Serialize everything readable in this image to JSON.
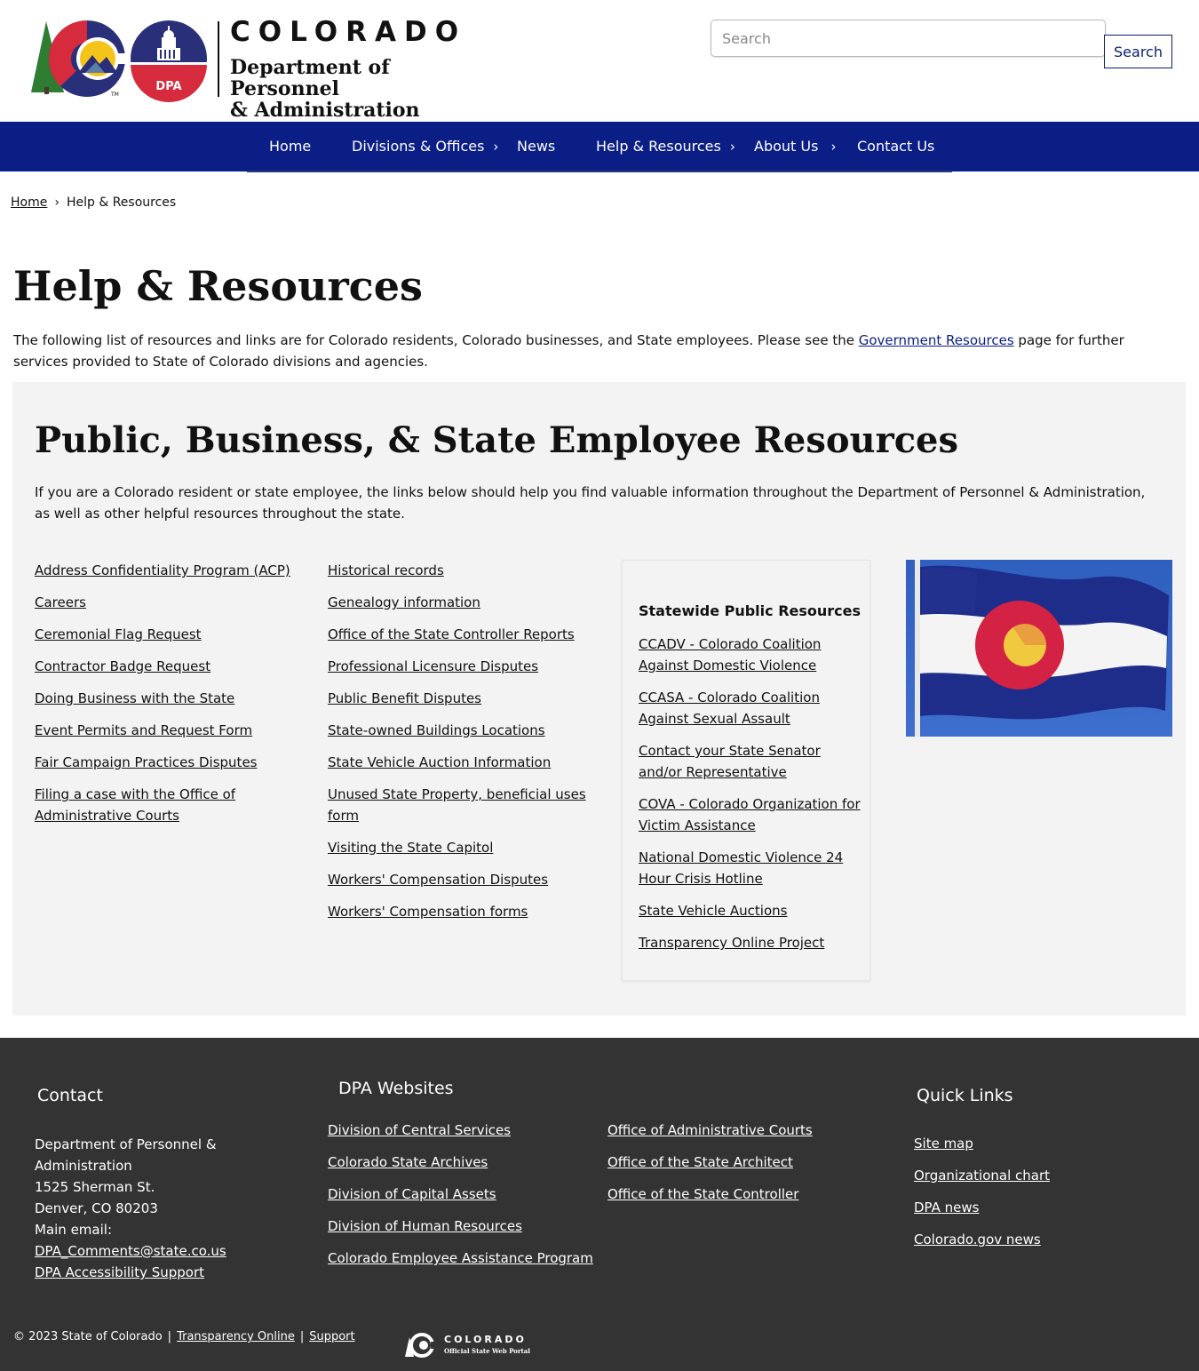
{
  "header": {
    "logo_state": "COLORADO",
    "logo_dept_line1": "Department of Personnel",
    "logo_dept_line2": "& Administration",
    "logo_badge": "DPA",
    "search_placeholder": "Search",
    "search_button": "Search"
  },
  "nav": {
    "items": [
      {
        "label": "Home",
        "has_submenu": false
      },
      {
        "label": "Divisions & Offices",
        "has_submenu": true
      },
      {
        "label": "News",
        "has_submenu": false
      },
      {
        "label": "Help & Resources",
        "has_submenu": true
      },
      {
        "label": "About Us",
        "has_submenu": true
      },
      {
        "label": "Contact Us",
        "has_submenu": false
      }
    ],
    "chevron": "›"
  },
  "breadcrumb": {
    "home": "Home",
    "separator": "›",
    "current": "Help & Resources"
  },
  "main": {
    "title": "Help & Resources",
    "intro_before": "The following list of resources and links are for Colorado residents, Colorado businesses, and State employees. Please see the ",
    "intro_link": "Government Resources",
    "intro_after": " page for further services provided to State of Colorado divisions and agencies."
  },
  "panel": {
    "title": "Public, Business, & State Employee Resources",
    "description": "If you are a Colorado resident or state employee, the links below should help you find valuable information throughout the Department of Personnel & Administration, as well as other helpful resources throughout the state.",
    "col1": [
      "Address Confidentiality Program (ACP)",
      "Careers",
      "Ceremonial Flag Request",
      "Contractor Badge Request",
      "Doing Business with the State",
      "Event Permits and Request Form",
      "Fair Campaign Practices Disputes",
      "Filing a case with the Office of Administrative Courts"
    ],
    "col2": [
      "Historical records",
      "Genealogy information",
      "Office of the State Controller Reports",
      "Professional Licensure Disputes",
      "Public Benefit Disputes",
      "State-owned Buildings Locations",
      "State Vehicle Auction Information",
      "Unused State Property, beneficial uses form",
      "Visiting the State Capitol",
      "Workers' Compensation Disputes",
      "Workers' Compensation forms"
    ],
    "card_title": "Statewide Public Resources",
    "card_links": [
      "CCADV - Colorado Coalition Against Domestic Violence",
      "CCASA - Colorado Coalition Against Sexual Assault",
      "Contact your State Senator and/or Representative",
      "COVA - Colorado Organization for Victim Assistance",
      "National Domestic Violence 24 Hour Crisis Hotline",
      "State Vehicle Auctions",
      "Transparency Online Project"
    ]
  },
  "footer": {
    "contact_heading": "Contact",
    "contact_lines": [
      "Department of Personnel & Administration",
      "1525 Sherman St.",
      "Denver, CO 80203",
      "Main email:"
    ],
    "contact_email": "DPA_Comments@state.co.us",
    "contact_accessibility": "DPA Accessibility Support",
    "websites_heading": "DPA Websites",
    "websites_col1": [
      "Division of Central Services",
      "Colorado State Archives",
      "Division of Capital Assets",
      "Division of Human Resources",
      "Colorado Employee Assistance Program"
    ],
    "websites_col2": [
      "Office of Administrative Courts",
      "Office of the State Architect",
      "Office of the State Controller"
    ],
    "quick_heading": "Quick Links",
    "quick_links": [
      "Site map",
      "Organizational chart",
      "DPA news",
      "Colorado.gov news"
    ]
  },
  "subfooter": {
    "copyright": "© 2023 State of Colorado",
    "separator": "|",
    "link1": "Transparency Online",
    "link2": "Support",
    "portal_title": "COLORADO",
    "portal_sub": "Official State Web Portal"
  },
  "colors": {
    "nav_blue": "#0a1e86",
    "footer_gray": "#333333",
    "panel_gray": "#f3f3f3",
    "logo_red": "#d52b3d",
    "logo_navy": "#2a2f7a",
    "logo_gold": "#f5c41b",
    "logo_green": "#2e7d32"
  },
  "icons": {
    "state_logo": "colorado-c-logo-icon",
    "dpa_badge": "capitol-dome-icon",
    "nav_chevron": "chevron-right-icon",
    "flag_image": "colorado-flag-image",
    "portal_logo": "colorado-portal-logo-icon"
  }
}
